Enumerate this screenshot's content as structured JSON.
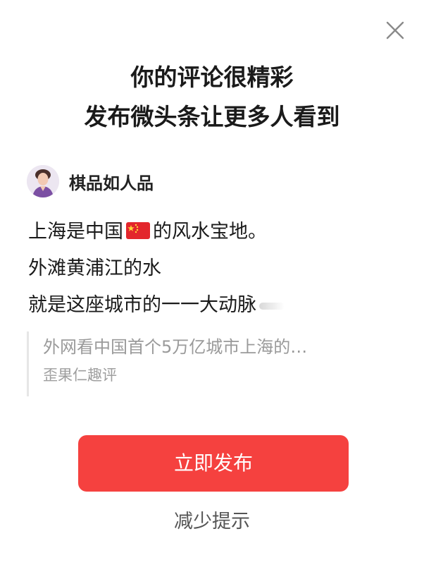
{
  "dialog": {
    "close_icon": "close-icon",
    "title_line1": "你的评论很精彩",
    "title_line2": "发布微头条让更多人看到"
  },
  "author": {
    "avatar_icon": "avatar",
    "name": "棋品如人品"
  },
  "comment": {
    "line1_before_flag": "上海是中国",
    "flag_icon": "china-flag-icon",
    "line1_after_flag": "的风水宝地。",
    "line2": "外滩黄浦江的水",
    "line3": "就是这座城市的一一大动脉"
  },
  "quote": {
    "title": "外网看中国首个5万亿城市上海的…",
    "source": "歪果仁趣评"
  },
  "actions": {
    "publish_label": "立即发布",
    "reduce_label": "减少提示"
  },
  "colors": {
    "accent": "#f5413f",
    "title_text": "#1a1a1a",
    "muted_text": "#9a9a9a"
  }
}
